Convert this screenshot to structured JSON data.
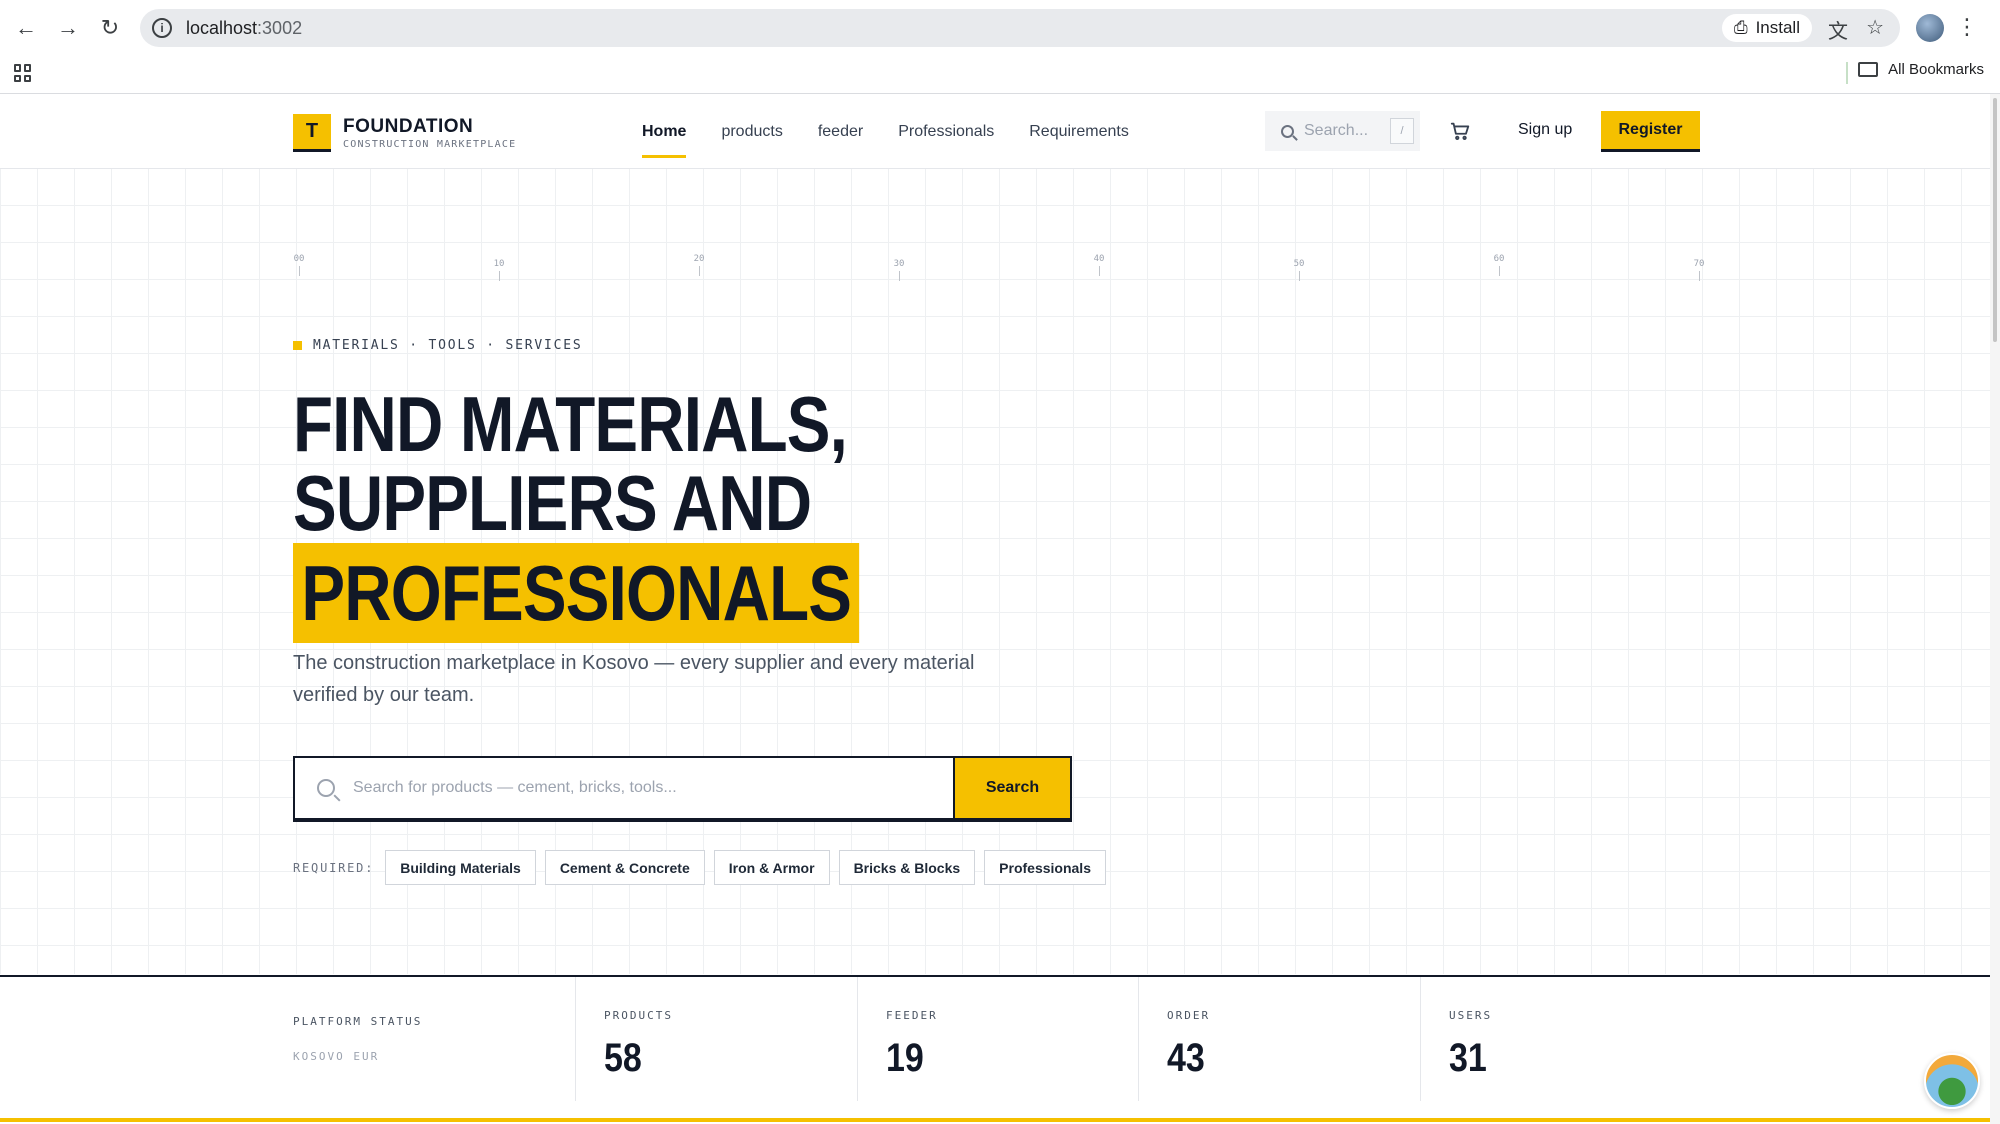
{
  "browser": {
    "url_host": "localhost",
    "url_port": ":3002",
    "install_label": "Install",
    "bookmarks_label": "All Bookmarks"
  },
  "header": {
    "logo_letter": "T",
    "logo_title": "FOUNDATION",
    "logo_subtitle": "CONSTRUCTION MARKETPLACE",
    "nav": [
      "Home",
      "products",
      "feeder",
      "Professionals",
      "Requirements"
    ],
    "active_nav": "Home",
    "search_placeholder": "Search...",
    "search_shortcut": "/",
    "signup_label": "Sign up",
    "register_label": "Register"
  },
  "ruler": {
    "ticks": [
      "00",
      "10",
      "20",
      "30",
      "40",
      "50",
      "60",
      "70"
    ]
  },
  "hero": {
    "eyebrow": "MATERIALS · TOOLS · SERVICES",
    "title_line1": "FIND MATERIALS,",
    "title_line2": "SUPPLIERS AND",
    "title_highlight": "PROFESSIONALS",
    "lead": "The construction marketplace in Kosovo — every supplier and every material verified by our team.",
    "search_placeholder": "Search for products — cement, bricks, tools...",
    "search_button": "Search",
    "required_label": "REQUIRED:",
    "chips": [
      "Building Materials",
      "Cement & Concrete",
      "Iron & Armor",
      "Bricks & Blocks",
      "Professionals"
    ]
  },
  "stats": {
    "status_title": "PLATFORM STATUS",
    "status_sub": "KOSOVO EUR",
    "items": [
      {
        "label": "PRODUCTS",
        "value": "58"
      },
      {
        "label": "FEEDER",
        "value": "19"
      },
      {
        "label": "ORDER",
        "value": "43"
      },
      {
        "label": "USERS",
        "value": "31"
      }
    ]
  },
  "colors": {
    "accent": "#f5c000",
    "ink": "#111827"
  }
}
